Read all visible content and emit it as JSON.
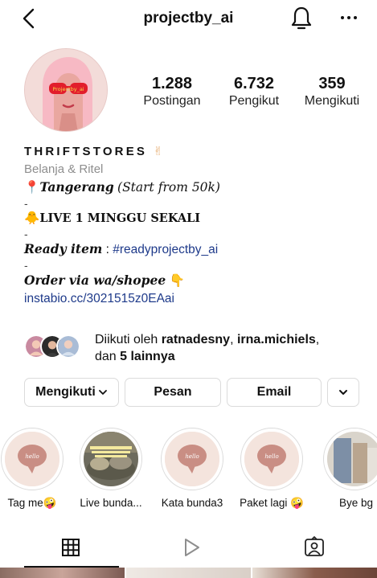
{
  "header": {
    "username": "projectby_ai"
  },
  "profile": {
    "avatar_text": "Projectby_ai",
    "stats": [
      {
        "value": "1.288",
        "label": "Postingan"
      },
      {
        "value": "6.732",
        "label": "Pengikut"
      },
      {
        "value": "359",
        "label": "Mengikuti"
      }
    ]
  },
  "bio": {
    "name": "THRIFTSTORES",
    "name_emoji": "✌",
    "category": "Belanja & Ritel",
    "location_pin": "📍",
    "location_label": "Tangerang",
    "location_paren": "(Start from 50k)",
    "dash": "-",
    "live_emoji": "🐥",
    "live_text": "LIVE 1 MINGGU SEKALI",
    "ready_label": "Ready item",
    "ready_sep": " : ",
    "ready_tag": "#readyprojectby_ai",
    "order_text": "Order via wa/shopee",
    "order_emoji": "👇",
    "link": "instabio.cc/3021515z0EAai"
  },
  "followed_by": {
    "prefix": "Diikuti oleh ",
    "user1": "ratnadesny",
    "sep": ", ",
    "user2": "irna.michiels",
    "suffix_pre": ",",
    "line2_pre": "dan ",
    "others": "5 lainnya"
  },
  "actions": {
    "follow_label": "Mengikuti",
    "message_label": "Pesan",
    "email_label": "Email"
  },
  "highlights": [
    {
      "label": "Tag me🤪",
      "cover": "hello"
    },
    {
      "label": "Live bunda...",
      "cover": "photo"
    },
    {
      "label": "Kata bunda3",
      "cover": "hello"
    },
    {
      "label": "Paket lagi 🤪",
      "cover": "hello"
    },
    {
      "label": "Bye bg",
      "cover": "photo"
    }
  ],
  "highlight_bubble_text": "hello",
  "colors": {
    "link": "#1e3a8a",
    "muted": "#8e8e8e",
    "border": "#dbdbdb",
    "highlight_bg": "#f4e4dd",
    "bubble": "#c98e84"
  }
}
